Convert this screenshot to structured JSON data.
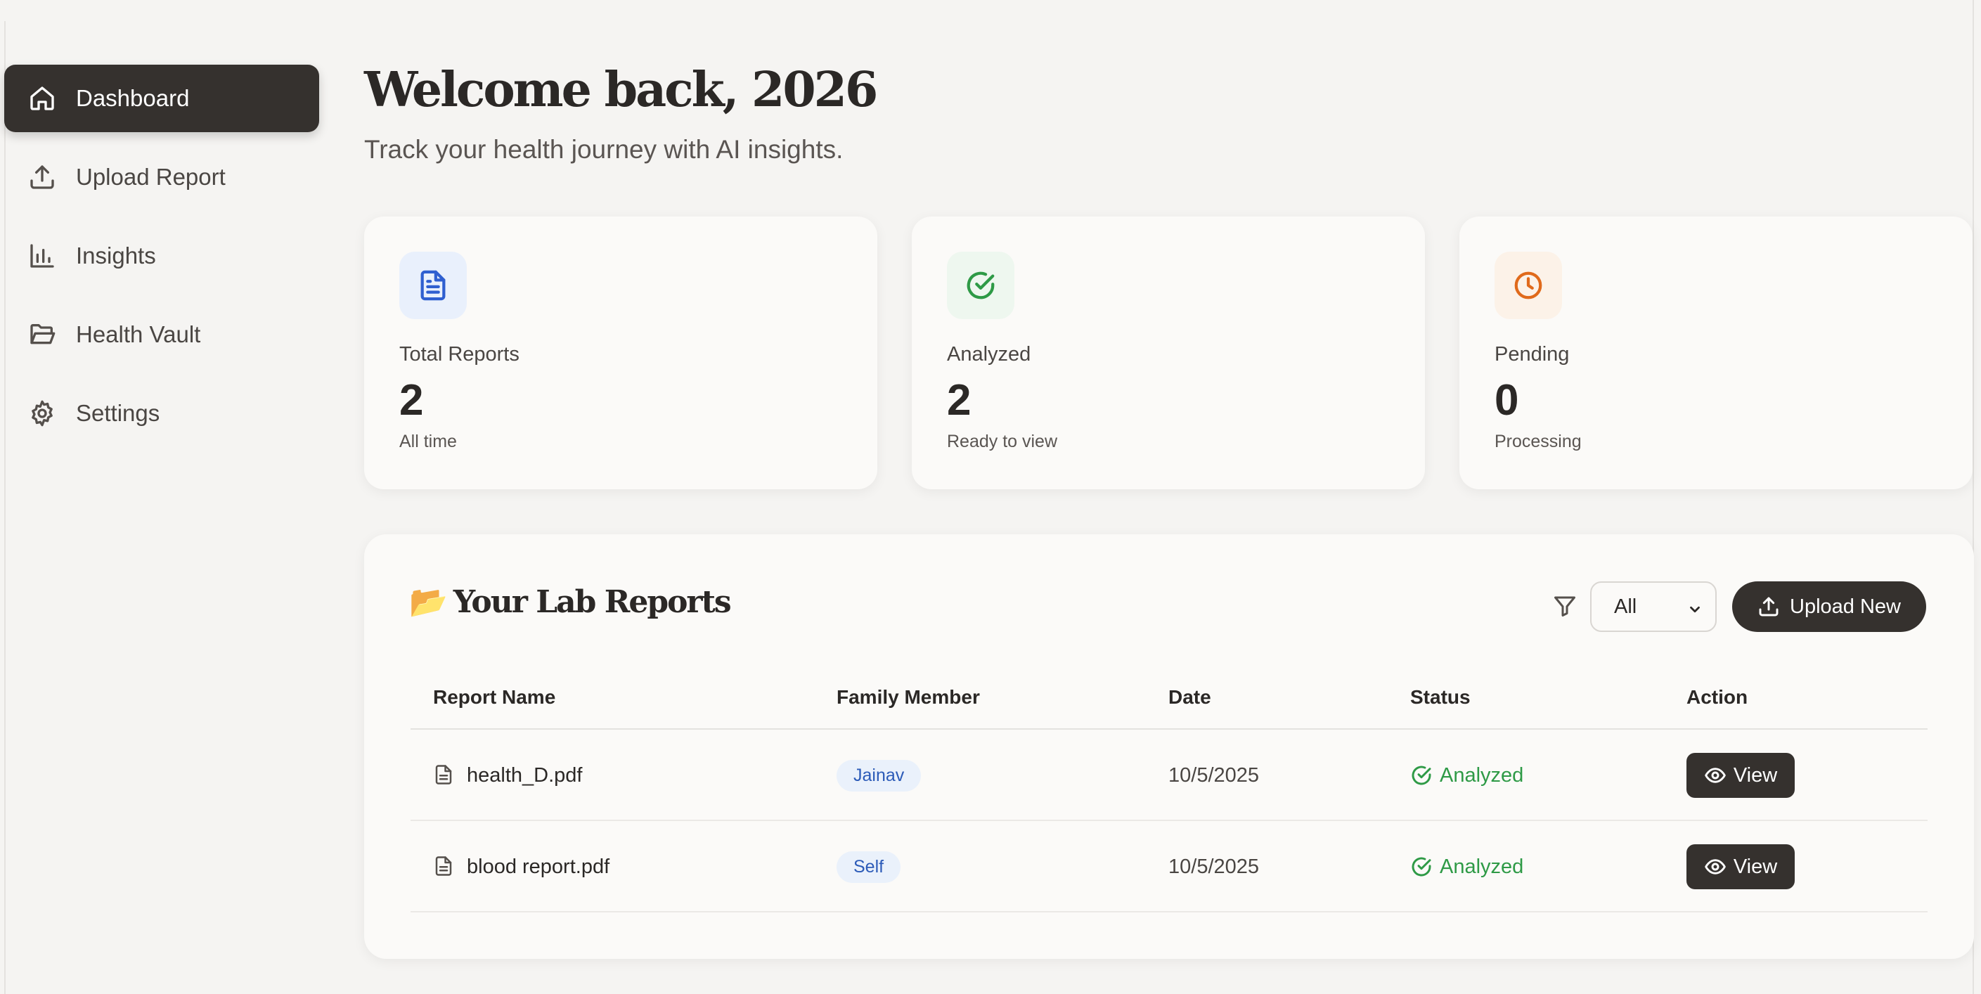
{
  "sidebar": {
    "items": [
      {
        "label": "Dashboard",
        "icon": "home-icon",
        "active": true
      },
      {
        "label": "Upload Report",
        "icon": "upload-icon",
        "active": false
      },
      {
        "label": "Insights",
        "icon": "bar-chart-icon",
        "active": false
      },
      {
        "label": "Health Vault",
        "icon": "folder-open-icon",
        "active": false
      },
      {
        "label": "Settings",
        "icon": "gear-icon",
        "active": false
      }
    ]
  },
  "header": {
    "title": "Welcome back, 2026",
    "subtitle": "Track your health journey with AI insights."
  },
  "stats": [
    {
      "label": "Total Reports",
      "value": "2",
      "sub": "All time",
      "icon": "document-icon",
      "icon_color": "#2f5fd0",
      "icon_bg": "#e9f0fc"
    },
    {
      "label": "Analyzed",
      "value": "2",
      "sub": "Ready to view",
      "icon": "check-circle-icon",
      "icon_color": "#2e9a46",
      "icon_bg": "#eef7ef"
    },
    {
      "label": "Pending",
      "value": "0",
      "sub": "Processing",
      "icon": "clock-icon",
      "icon_color": "#e06a1b",
      "icon_bg": "#fcf2e8"
    }
  ],
  "reports_panel": {
    "emoji": "📂",
    "title": "Your Lab Reports",
    "filter_icon": "filter-icon",
    "filter_value": "All",
    "upload_label": "Upload New",
    "columns": [
      "Report Name",
      "Family Member",
      "Date",
      "Status",
      "Action"
    ],
    "rows": [
      {
        "name": "health_D.pdf",
        "member": "Jainav",
        "date": "10/5/2025",
        "status": "Analyzed",
        "action": "View"
      },
      {
        "name": "blood report.pdf",
        "member": "Self",
        "date": "10/5/2025",
        "status": "Analyzed",
        "action": "View"
      }
    ]
  },
  "colors": {
    "accent_dark": "#35312e",
    "success": "#2e9a46",
    "badge_text": "#2c5bb8",
    "background": "#f5f4f2"
  }
}
